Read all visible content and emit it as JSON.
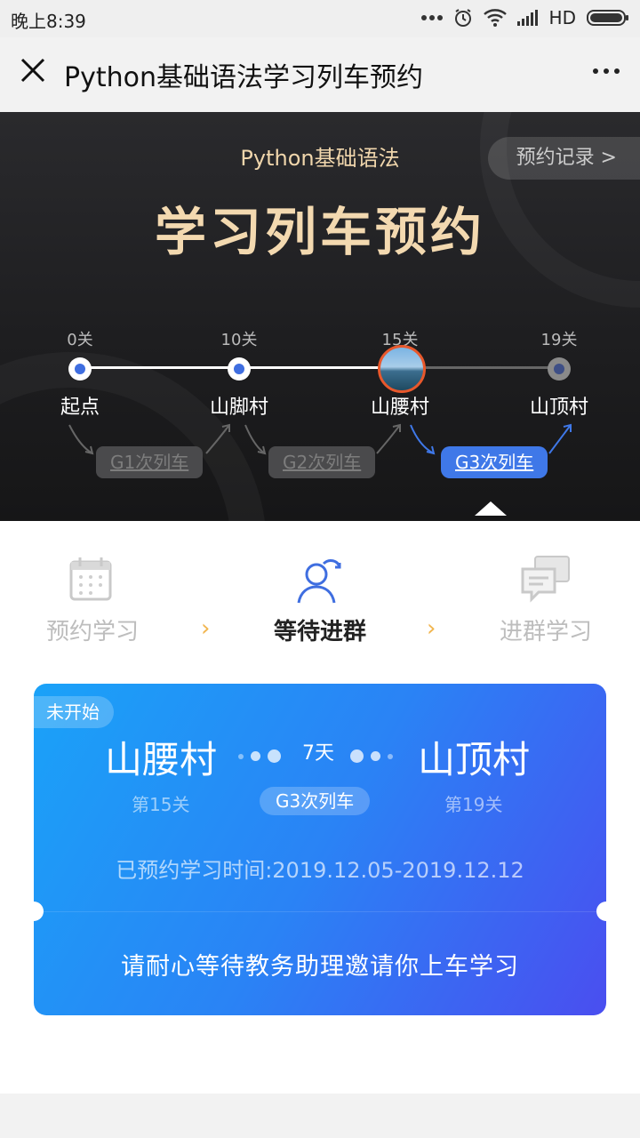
{
  "status_bar": {
    "time": "晚上8:39",
    "network": "HD"
  },
  "nav": {
    "title": "Python基础语法学习列车预约"
  },
  "hero": {
    "subtitle": "Python基础语法",
    "title": "学习列车预约",
    "records_button": "预约记录 >",
    "stops": [
      {
        "level": "0关",
        "name": "起点"
      },
      {
        "level": "10关",
        "name": "山脚村"
      },
      {
        "level": "15关",
        "name": "山腰村"
      },
      {
        "level": "19关",
        "name": "山顶村"
      }
    ],
    "trains": [
      "G1次列车",
      "G2次列车",
      "G3次列车"
    ]
  },
  "steps": [
    {
      "label": "预约学习",
      "icon": "calendar-icon"
    },
    {
      "label": "等待进群",
      "icon": "user-join-icon"
    },
    {
      "label": "进群学习",
      "icon": "chat-icon"
    }
  ],
  "step_arrow": "›",
  "card": {
    "status": "未开始",
    "from": "山腰村",
    "to": "山顶村",
    "days": "7天",
    "from_level": "第15关",
    "to_level": "第19关",
    "train": "G3次列车",
    "booked_time": "已预约学习时间:2019.12.05-2019.12.12",
    "message": "请耐心等待教务助理邀请你上车学习"
  },
  "colors": {
    "accent": "#3f78e8",
    "gold": "#f3d9b0",
    "arrow": "#f1b54e"
  }
}
